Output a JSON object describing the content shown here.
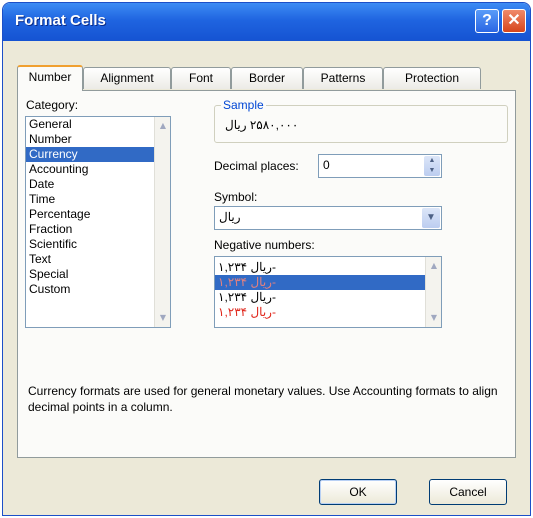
{
  "window": {
    "title": "Format Cells",
    "help_glyph": "?",
    "close_glyph": "✕"
  },
  "tabs": [
    {
      "label": "Number",
      "active": true
    },
    {
      "label": "Alignment"
    },
    {
      "label": "Font"
    },
    {
      "label": "Border"
    },
    {
      "label": "Patterns"
    },
    {
      "label": "Protection"
    }
  ],
  "category": {
    "label": "Category:",
    "items": [
      "General",
      "Number",
      "Currency",
      "Accounting",
      "Date",
      "Time",
      "Percentage",
      "Fraction",
      "Scientific",
      "Text",
      "Special",
      "Custom"
    ],
    "selected": "Currency"
  },
  "sample": {
    "label": "Sample",
    "value": "۲۵۸۰,۰۰۰ ریال"
  },
  "decimal_places": {
    "label": "Decimal places:",
    "value": "0"
  },
  "symbol": {
    "label": "Symbol:",
    "value": "ریال"
  },
  "negative_numbers": {
    "label": "Negative numbers:",
    "items": [
      {
        "text": "۱,۲۳۴ ریال-",
        "red": false
      },
      {
        "text": "۱,۲۳۴ ریال-",
        "red": true,
        "selected": true
      },
      {
        "text": "۱,۲۳۴ ریال-",
        "red": false
      },
      {
        "text": "۱,۲۳۴ ریال-",
        "red": true
      }
    ]
  },
  "description": "Currency formats are used for general monetary values.  Use Accounting formats to align decimal points in a column.",
  "buttons": {
    "ok": "OK",
    "cancel": "Cancel"
  },
  "colors": {
    "titlebar": "#1f64e0",
    "selection": "#316ac5",
    "negative_red": "#e0261b",
    "group_title": "#0046d5"
  }
}
